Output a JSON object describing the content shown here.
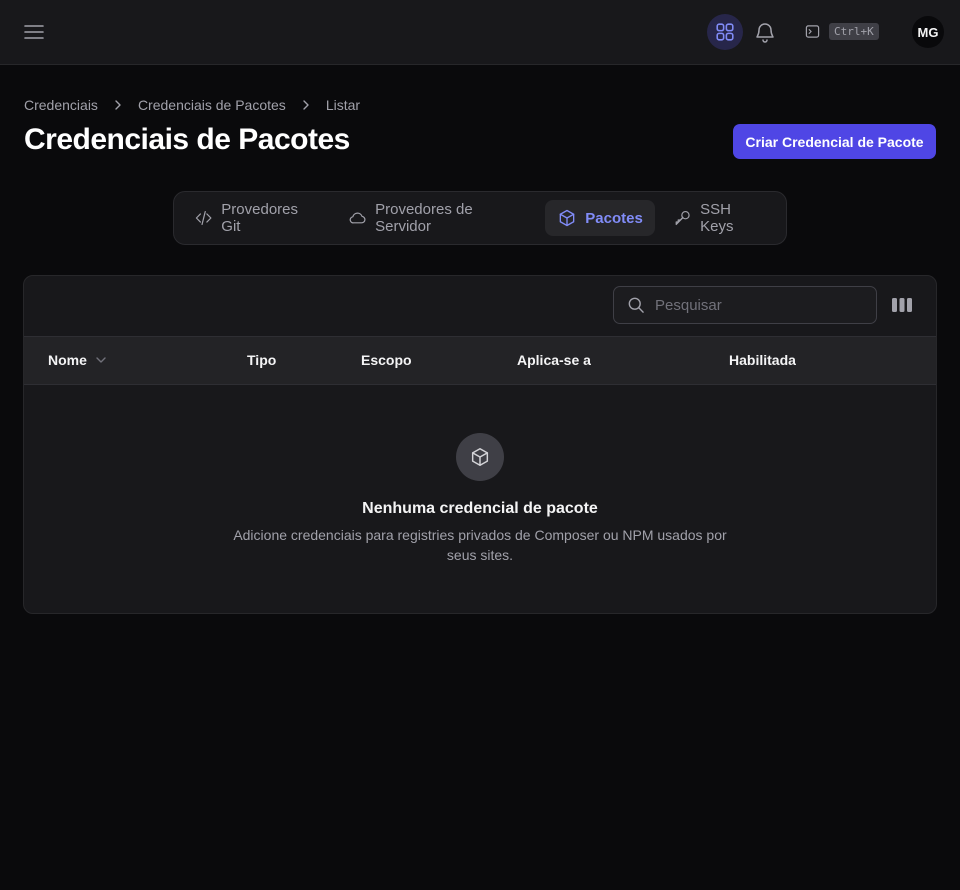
{
  "header": {
    "shortcut_key": "Ctrl+K",
    "avatar_initials": "MG"
  },
  "breadcrumb": [
    "Credenciais",
    "Credenciais de Pacotes",
    "Listar"
  ],
  "page": {
    "title": "Credenciais de Pacotes",
    "create_button": "Criar Credencial de Pacote"
  },
  "tabs": [
    {
      "label": "Provedores Git",
      "icon": "code-icon",
      "active": false
    },
    {
      "label": "Provedores de Servidor",
      "icon": "cloud-icon",
      "active": false
    },
    {
      "label": "Pacotes",
      "icon": "cube-icon",
      "active": true
    },
    {
      "label": "SSH Keys",
      "icon": "key-icon",
      "active": false
    }
  ],
  "table": {
    "search_placeholder": "Pesquisar",
    "columns": [
      "Nome",
      "Tipo",
      "Escopo",
      "Aplica-se a",
      "Habilitada"
    ],
    "empty_title": "Nenhuma credencial de pacote",
    "empty_description": "Adicione credenciais para registries privados de Composer ou NPM usados por seus sites."
  },
  "colors": {
    "accent": "#4f46e5",
    "active_tab_text": "#818cf8",
    "background": "#0a0a0c",
    "surface": "#18181b"
  }
}
